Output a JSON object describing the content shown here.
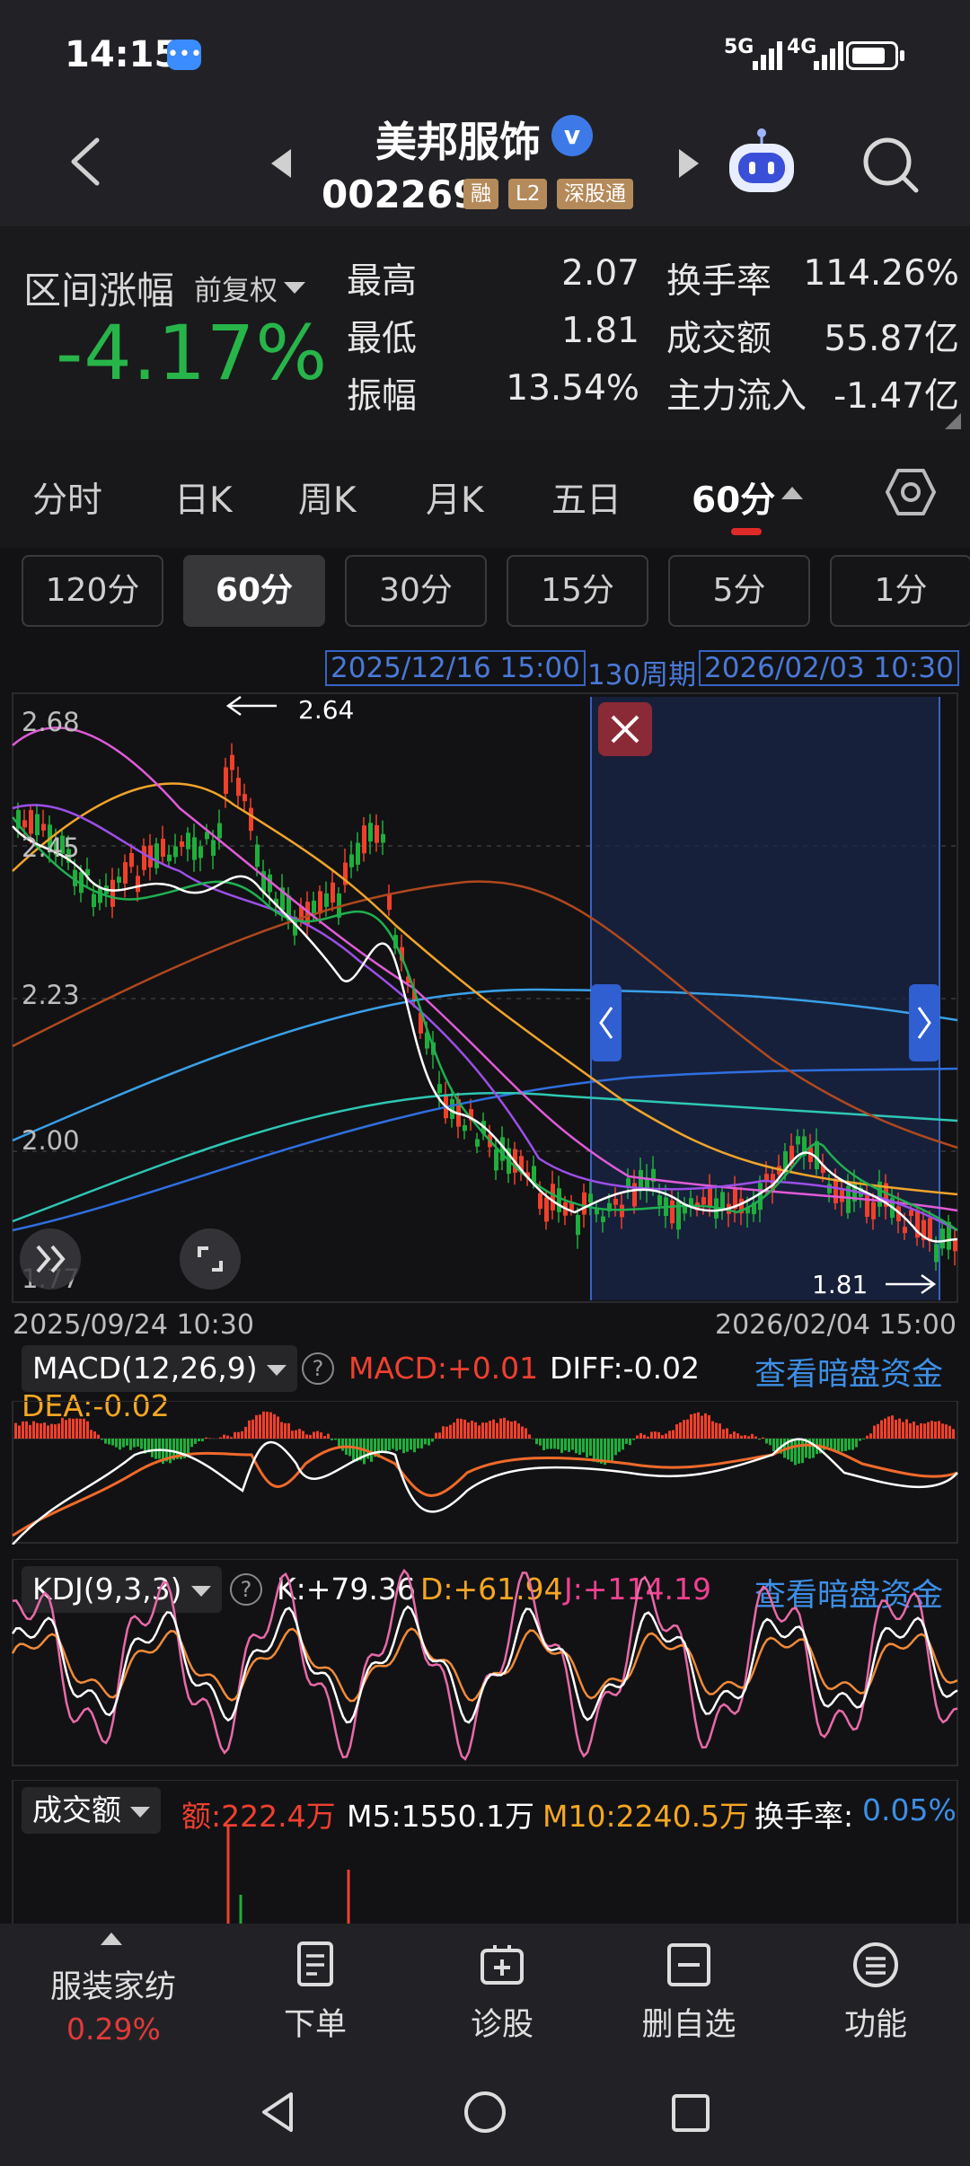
{
  "status": {
    "time": "14:15",
    "sig1": "5G",
    "sig2": "4G"
  },
  "header": {
    "name": "美邦服饰",
    "code": "002269",
    "tags": [
      "融",
      "L2",
      "深股通"
    ]
  },
  "stats": {
    "range_label": "区间涨幅",
    "adjust_label": "前复权",
    "range_value": "-4.17%",
    "rows": [
      {
        "l1": "最高",
        "v1": "2.07",
        "l2": "换手率",
        "v2": "114.26%"
      },
      {
        "l1": "最低",
        "v1": "1.81",
        "l2": "成交额",
        "v2": "55.87亿"
      },
      {
        "l1": "振幅",
        "v1": "13.54%",
        "l2": "主力流入",
        "v2": "-1.47亿"
      }
    ]
  },
  "tabs": [
    "分时",
    "日K",
    "周K",
    "月K",
    "五日",
    "60分"
  ],
  "sub_tabs": [
    "120分",
    "60分",
    "30分",
    "15分",
    "5分",
    "1分"
  ],
  "chart": {
    "range_start": "2025/12/16 15:00",
    "period_count": "130周期",
    "range_end": "2026/02/03 10:30",
    "y_labels": [
      "2.68",
      "2.45",
      "2.23",
      "2.00",
      "1.77"
    ],
    "high_marker": "2.64",
    "low_marker": "1.81",
    "x_start": "2025/09/24 10:30",
    "x_end": "2026/02/04 15:00",
    "colors": {
      "up": "#f0402a",
      "down": "#1fae3b",
      "selection": "#3863c4"
    }
  },
  "macd": {
    "label": "MACD(12,26,9)",
    "macd": "MACD:+0.01",
    "diff": "DIFF:-0.02",
    "dea": "DEA:-0.02",
    "link": "查看暗盘资金"
  },
  "kdj": {
    "label": "KDJ(9,3,3)",
    "k": "K:+79.36",
    "d": "D:+61.94",
    "j": "J:+114.19",
    "link": "查看暗盘资金"
  },
  "volume": {
    "label": "成交额",
    "amount": "额:222.4万",
    "m5": "M5:1550.1万",
    "m10": "M10:2240.5万",
    "turnover_label": "换手率:",
    "turnover_value": "0.05%"
  },
  "bottom": {
    "industry": "服装家纺",
    "industry_pct": "0.29%",
    "items": [
      "下单",
      "诊股",
      "删自选",
      "功能"
    ]
  }
}
